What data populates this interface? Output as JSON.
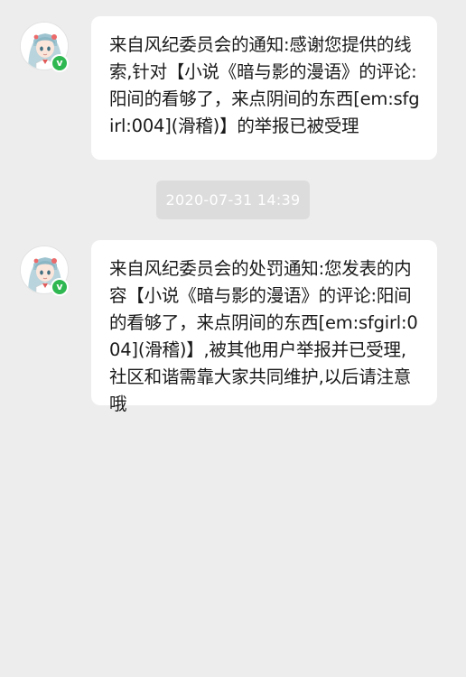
{
  "messages": [
    {
      "text": "来自风纪委员会的通知:感谢您提供的线索,针对【小说《暗与影的漫语》的评论:阳间的看够了，来点阴间的东西[em:sfgirl:004](滑稽)】的举报已被受理",
      "badge": "v"
    },
    {
      "text": "来自风纪委员会的处罚通知:您发表的内容【小说《暗与影的漫语》的评论:阳间的看够了，来点阴间的东西[em:sfgirl:004](滑稽)】,被其他用户举报并已受理,社区和谐需靠大家共同维护,以后请注意哦",
      "badge": "v"
    }
  ],
  "timestamp": "2020-07-31 14:39",
  "icons": {
    "avatar": "anime-girl-avatar-icon",
    "badge": "verified-check-icon"
  },
  "colors": {
    "background": "#ededed",
    "bubble": "#ffffff",
    "verified_badge": "#2fb852",
    "timestamp_bg": "#dcdcdc"
  }
}
